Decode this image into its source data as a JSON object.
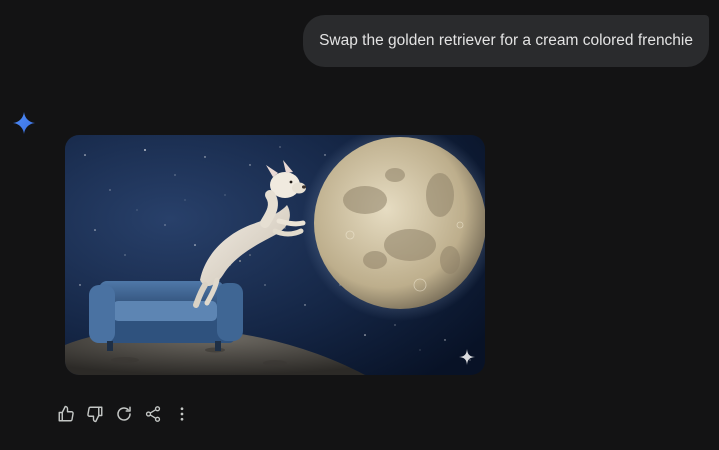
{
  "conversation": {
    "user_message": "Swap the golden retriever for a cream colored frenchie",
    "assistant": {
      "avatar_icon": "gemini-sparkle-icon",
      "image": {
        "subject": "generated-image",
        "badge_icon": "sparkle-icon"
      },
      "actions": [
        {
          "name": "thumbs-up-icon"
        },
        {
          "name": "thumbs-down-icon"
        },
        {
          "name": "regenerate-icon"
        },
        {
          "name": "share-icon"
        },
        {
          "name": "more-options-icon"
        }
      ]
    }
  },
  "colors": {
    "background": "#131314",
    "bubble": "#2a2b2d",
    "text": "#e3e3e3",
    "accent": "#4285f4",
    "icon": "#c4c7c5"
  }
}
